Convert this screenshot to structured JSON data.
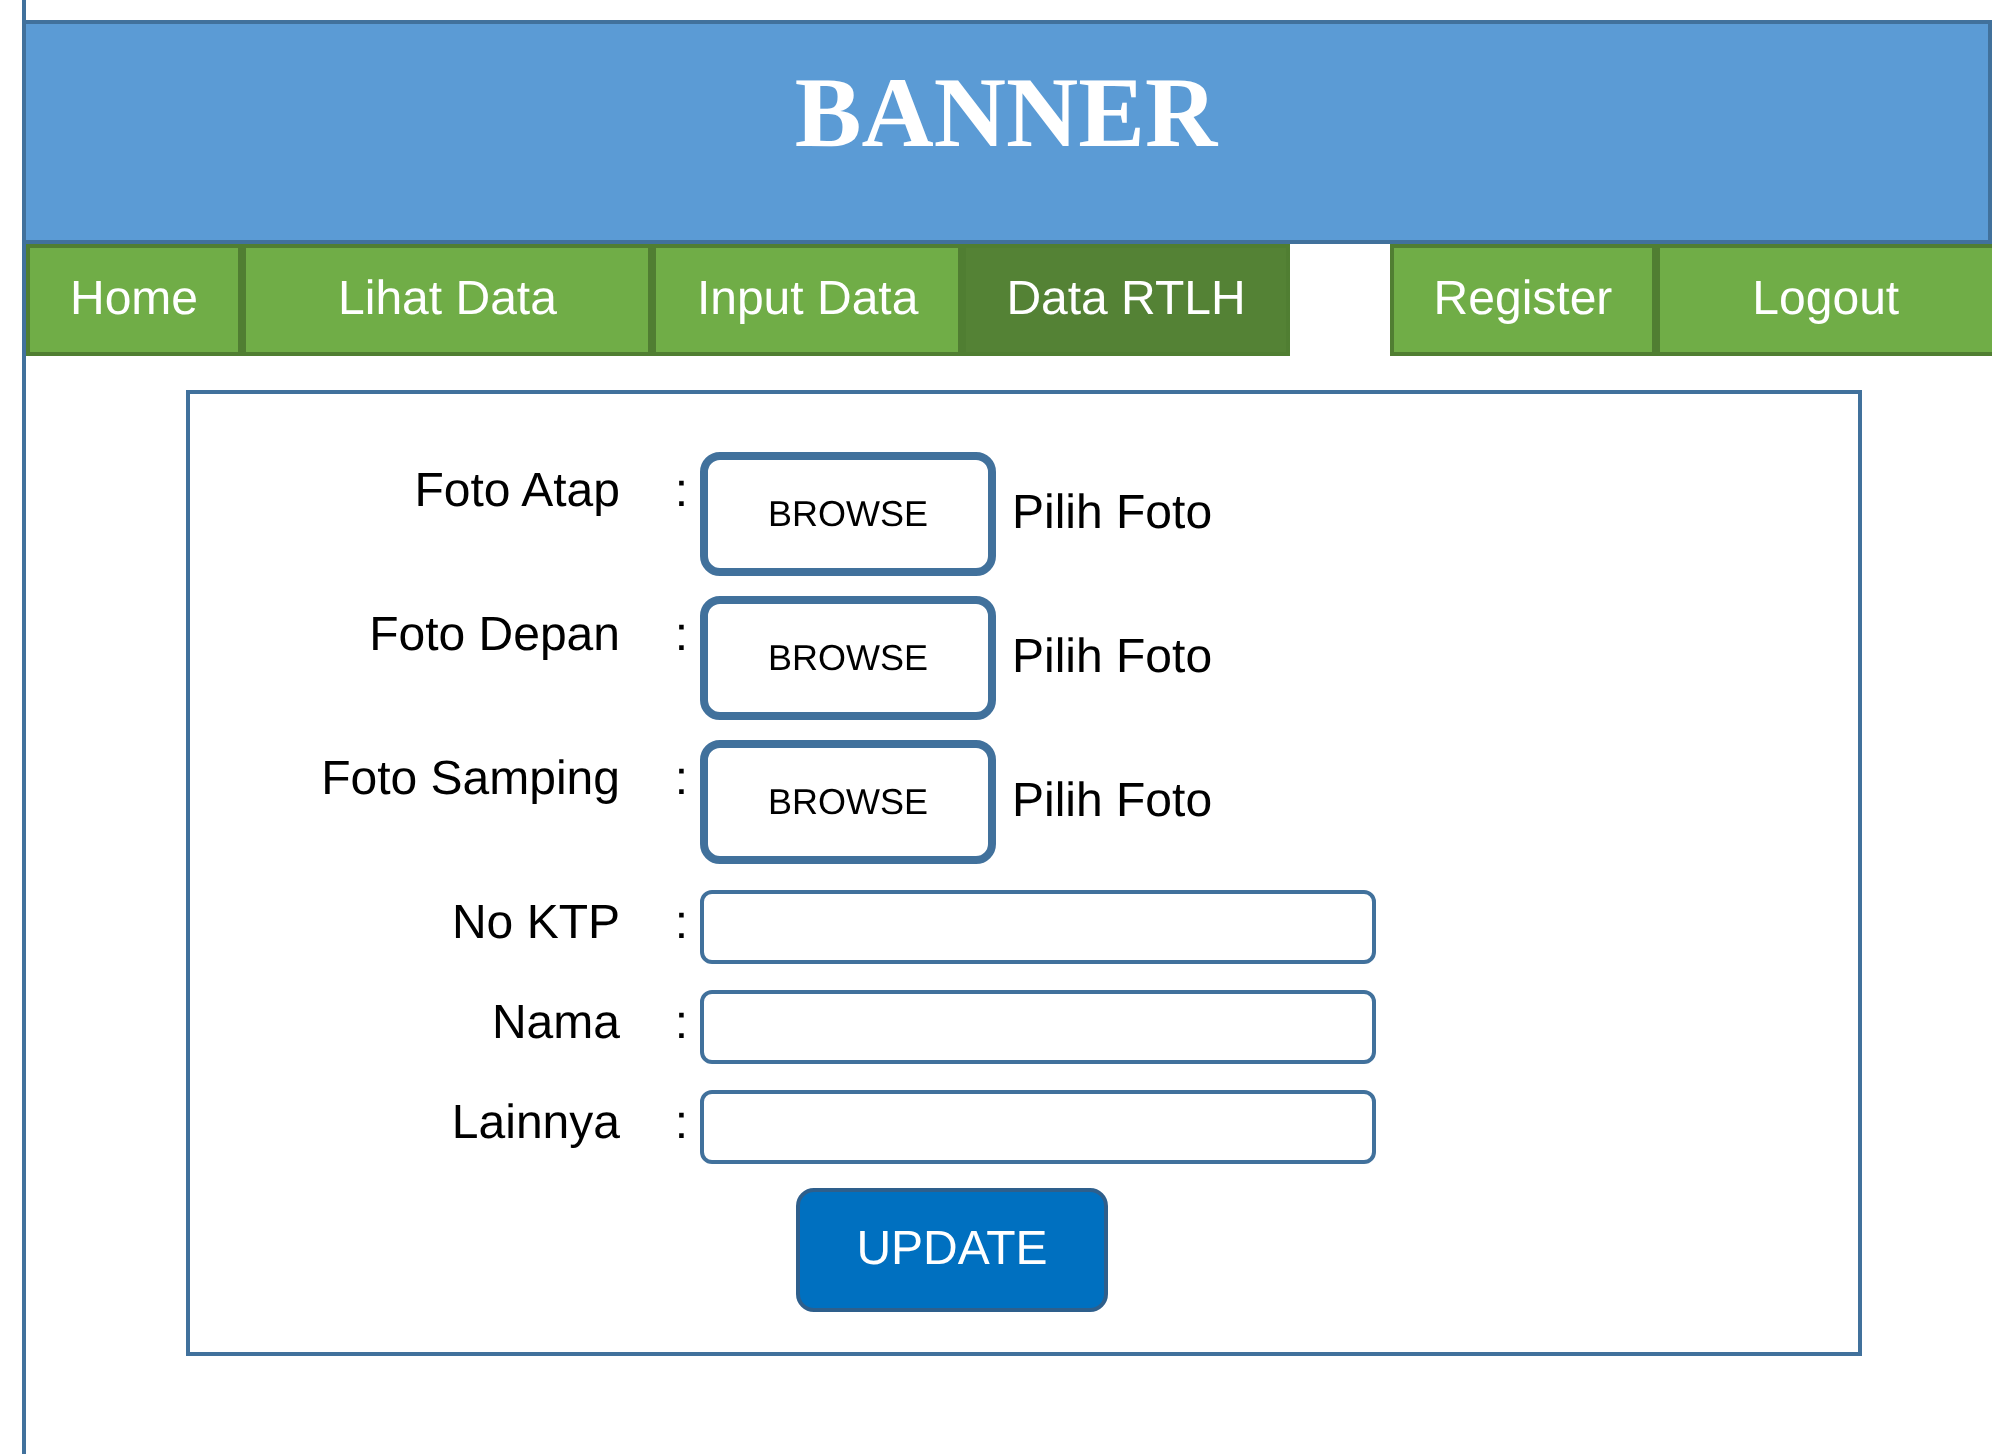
{
  "banner": {
    "title": "BANNER"
  },
  "nav_tabs": [
    {
      "label": "Home",
      "selected": false
    },
    {
      "label": "Lihat Data",
      "selected": false
    },
    {
      "label": "Input Data",
      "selected": false
    },
    {
      "label": "Data RTLH",
      "selected": true
    }
  ],
  "account_tabs": [
    {
      "label": "Register",
      "selected": false
    },
    {
      "label": "Logout",
      "selected": false
    }
  ],
  "form": {
    "fields": [
      {
        "kind": "file",
        "label": "Foto Atap",
        "separator": ":",
        "button": "BROWSE",
        "hint": "Pilih Foto"
      },
      {
        "kind": "file",
        "label": "Foto Depan",
        "separator": ":",
        "button": "BROWSE",
        "hint": "Pilih Foto"
      },
      {
        "kind": "file",
        "label": "Foto Samping",
        "separator": ":",
        "button": "BROWSE",
        "hint": "Pilih Foto"
      },
      {
        "kind": "text",
        "label": "No KTP",
        "separator": ":"
      },
      {
        "kind": "text",
        "label": "Nama",
        "separator": ":"
      },
      {
        "kind": "text",
        "label": "Lainnya",
        "separator": ":"
      }
    ],
    "submit": "UPDATE"
  }
}
